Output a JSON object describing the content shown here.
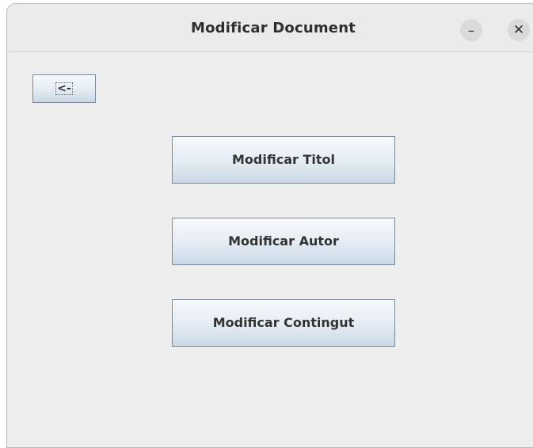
{
  "window": {
    "title": "Modificar Document",
    "minimize_glyph": "–",
    "close_glyph": "✕"
  },
  "main": {
    "back_label": "<-",
    "buttons": [
      {
        "label": "Modificar Titol"
      },
      {
        "label": "Modificar Autor"
      },
      {
        "label": "Modificar Contingut"
      }
    ]
  },
  "colors": {
    "window_bg": "#eeeeee",
    "button_border": "#7a8a99",
    "button_gradient_top": "#f6f9fc",
    "button_gradient_bottom": "#c9d8e7"
  },
  "icons": {
    "minimize": "minimize-icon",
    "close": "close-icon"
  }
}
